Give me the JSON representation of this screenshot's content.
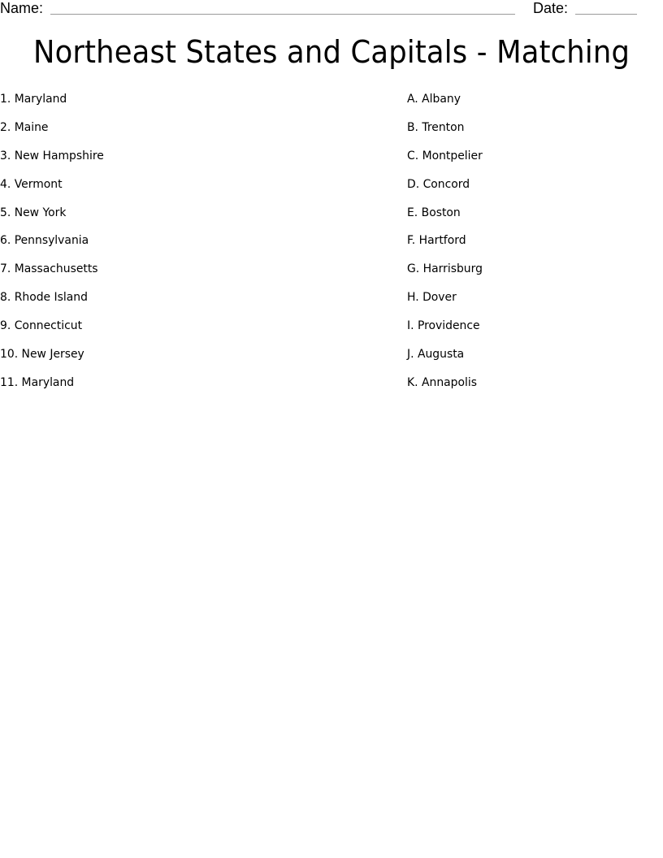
{
  "header": {
    "name_label": "Name:",
    "date_label": "Date:"
  },
  "title": "Northeast States and Capitals - Matching",
  "states": [
    "1. Maryland",
    "2. Maine",
    "3. New Hampshire",
    "4. Vermont",
    "5. New York",
    "6. Pennsylvania",
    "7. Massachusetts",
    "8. Rhode Island",
    "9. Connecticut",
    "10. New Jersey",
    "11. Maryland"
  ],
  "capitals": [
    "A. Albany",
    "B. Trenton",
    "C. Montpelier",
    "D. Concord",
    "E. Boston",
    "F. Hartford",
    "G. Harrisburg",
    "H. Dover",
    "I. Providence",
    "J. Augusta",
    "K. Annapolis"
  ]
}
